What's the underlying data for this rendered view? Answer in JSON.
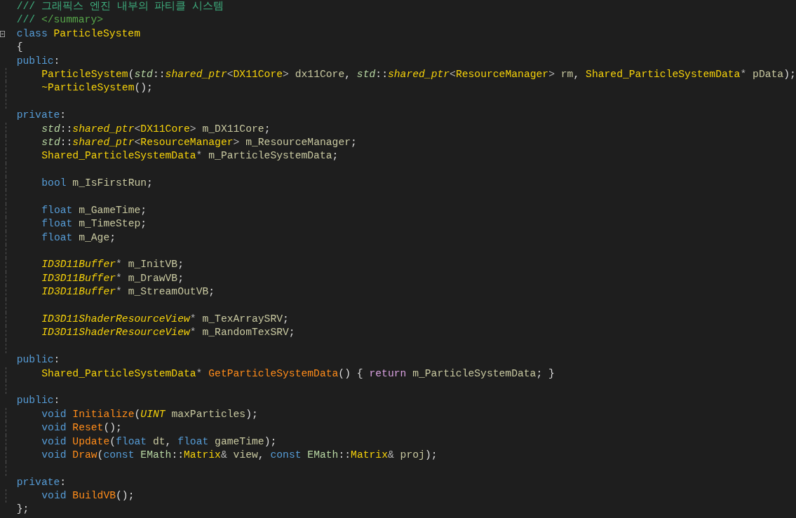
{
  "editor": {
    "lines": [
      {
        "kind": "code",
        "indented": false,
        "tokens": [
          {
            "kind": "comment",
            "t": "/// 그래픽스 엔진 내부의 파티클 시스템"
          }
        ]
      },
      {
        "kind": "code",
        "indented": false,
        "tokens": [
          {
            "kind": "comment",
            "t": "/// "
          },
          {
            "kind": "doc",
            "t": "</summary>"
          }
        ]
      },
      {
        "kind": "code",
        "indented": false,
        "fold_marker": true,
        "tokens": [
          {
            "kind": "kw",
            "t": "class "
          },
          {
            "kind": "class",
            "t": "ParticleSystem"
          }
        ]
      },
      {
        "kind": "code",
        "indented": false,
        "tokens": [
          {
            "kind": "punct",
            "t": "{"
          }
        ]
      },
      {
        "kind": "code",
        "indented": false,
        "tokens": [
          {
            "kind": "kw",
            "t": "public"
          },
          {
            "kind": "punct",
            "t": ":"
          }
        ]
      },
      {
        "kind": "code",
        "indented": true,
        "tokens": [
          {
            "kind": "class",
            "t": "ParticleSystem"
          },
          {
            "kind": "punct",
            "t": "("
          },
          {
            "kind": "ns",
            "t": "std"
          },
          {
            "kind": "punct",
            "t": "::"
          },
          {
            "kind": "tmpl",
            "t": "shared_ptr"
          },
          {
            "kind": "op",
            "t": "<"
          },
          {
            "kind": "class",
            "t": "DX11Core"
          },
          {
            "kind": "op",
            "t": ">"
          },
          {
            "kind": "var",
            "t": " dx11Core"
          },
          {
            "kind": "punct",
            "t": ", "
          },
          {
            "kind": "ns",
            "t": "std"
          },
          {
            "kind": "punct",
            "t": "::"
          },
          {
            "kind": "tmpl",
            "t": "shared_ptr"
          },
          {
            "kind": "op",
            "t": "<"
          },
          {
            "kind": "class",
            "t": "ResourceManager"
          },
          {
            "kind": "op",
            "t": ">"
          },
          {
            "kind": "var",
            "t": " rm"
          },
          {
            "kind": "punct",
            "t": ", "
          },
          {
            "kind": "class",
            "t": "Shared_ParticleSystemData"
          },
          {
            "kind": "op",
            "t": "*"
          },
          {
            "kind": "var",
            "t": " pData"
          },
          {
            "kind": "punct",
            "t": ");"
          }
        ]
      },
      {
        "kind": "code",
        "indented": true,
        "tokens": [
          {
            "kind": "class",
            "t": "~ParticleSystem"
          },
          {
            "kind": "punct",
            "t": "();"
          }
        ]
      },
      {
        "kind": "blank"
      },
      {
        "kind": "code",
        "indented": false,
        "tokens": [
          {
            "kind": "kw",
            "t": "private"
          },
          {
            "kind": "punct",
            "t": ":"
          }
        ]
      },
      {
        "kind": "code",
        "indented": true,
        "tokens": [
          {
            "kind": "ns",
            "t": "std"
          },
          {
            "kind": "punct",
            "t": "::"
          },
          {
            "kind": "tmpl",
            "t": "shared_ptr"
          },
          {
            "kind": "op",
            "t": "<"
          },
          {
            "kind": "class",
            "t": "DX11Core"
          },
          {
            "kind": "op",
            "t": ">"
          },
          {
            "kind": "var",
            "t": " m_DX11Core"
          },
          {
            "kind": "punct",
            "t": ";"
          }
        ]
      },
      {
        "kind": "code",
        "indented": true,
        "tokens": [
          {
            "kind": "ns",
            "t": "std"
          },
          {
            "kind": "punct",
            "t": "::"
          },
          {
            "kind": "tmpl",
            "t": "shared_ptr"
          },
          {
            "kind": "op",
            "t": "<"
          },
          {
            "kind": "class",
            "t": "ResourceManager"
          },
          {
            "kind": "op",
            "t": ">"
          },
          {
            "kind": "var",
            "t": " m_ResourceManager"
          },
          {
            "kind": "punct",
            "t": ";"
          }
        ]
      },
      {
        "kind": "code",
        "indented": true,
        "tokens": [
          {
            "kind": "class",
            "t": "Shared_ParticleSystemData"
          },
          {
            "kind": "op",
            "t": "*"
          },
          {
            "kind": "var",
            "t": " m_ParticleSystemData"
          },
          {
            "kind": "punct",
            "t": ";"
          }
        ]
      },
      {
        "kind": "blank"
      },
      {
        "kind": "code",
        "indented": true,
        "tokens": [
          {
            "kind": "kw",
            "t": "bool"
          },
          {
            "kind": "var",
            "t": " m_IsFirstRun"
          },
          {
            "kind": "punct",
            "t": ";"
          }
        ]
      },
      {
        "kind": "blank"
      },
      {
        "kind": "code",
        "indented": true,
        "tokens": [
          {
            "kind": "kw",
            "t": "float"
          },
          {
            "kind": "var",
            "t": " m_GameTime"
          },
          {
            "kind": "punct",
            "t": ";"
          }
        ]
      },
      {
        "kind": "code",
        "indented": true,
        "tokens": [
          {
            "kind": "kw",
            "t": "float"
          },
          {
            "kind": "var",
            "t": " m_TimeStep"
          },
          {
            "kind": "punct",
            "t": ";"
          }
        ]
      },
      {
        "kind": "code",
        "indented": true,
        "tokens": [
          {
            "kind": "kw",
            "t": "float"
          },
          {
            "kind": "var",
            "t": " m_Age"
          },
          {
            "kind": "punct",
            "t": ";"
          }
        ]
      },
      {
        "kind": "blank"
      },
      {
        "kind": "code",
        "indented": true,
        "tokens": [
          {
            "kind": "type",
            "t": "ID3D11Buffer"
          },
          {
            "kind": "op",
            "t": "*"
          },
          {
            "kind": "var",
            "t": " m_InitVB"
          },
          {
            "kind": "punct",
            "t": ";"
          }
        ]
      },
      {
        "kind": "code",
        "indented": true,
        "tokens": [
          {
            "kind": "type",
            "t": "ID3D11Buffer"
          },
          {
            "kind": "op",
            "t": "*"
          },
          {
            "kind": "var",
            "t": " m_DrawVB"
          },
          {
            "kind": "punct",
            "t": ";"
          }
        ]
      },
      {
        "kind": "code",
        "indented": true,
        "tokens": [
          {
            "kind": "type",
            "t": "ID3D11Buffer"
          },
          {
            "kind": "op",
            "t": "*"
          },
          {
            "kind": "var",
            "t": " m_StreamOutVB"
          },
          {
            "kind": "punct",
            "t": ";"
          }
        ]
      },
      {
        "kind": "blank"
      },
      {
        "kind": "code",
        "indented": true,
        "tokens": [
          {
            "kind": "type",
            "t": "ID3D11ShaderResourceView"
          },
          {
            "kind": "op",
            "t": "*"
          },
          {
            "kind": "var",
            "t": " m_TexArraySRV"
          },
          {
            "kind": "punct",
            "t": ";"
          }
        ]
      },
      {
        "kind": "code",
        "indented": true,
        "tokens": [
          {
            "kind": "type",
            "t": "ID3D11ShaderResourceView"
          },
          {
            "kind": "op",
            "t": "*"
          },
          {
            "kind": "var",
            "t": " m_RandomTexSRV"
          },
          {
            "kind": "punct",
            "t": ";"
          }
        ]
      },
      {
        "kind": "blank"
      },
      {
        "kind": "code",
        "indented": false,
        "tokens": [
          {
            "kind": "kw",
            "t": "public"
          },
          {
            "kind": "punct",
            "t": ":"
          }
        ]
      },
      {
        "kind": "code",
        "indented": true,
        "tokens": [
          {
            "kind": "class",
            "t": "Shared_ParticleSystemData"
          },
          {
            "kind": "op",
            "t": "*"
          },
          {
            "kind": "func",
            "t": " GetParticleSystemData"
          },
          {
            "kind": "punct",
            "t": "() { "
          },
          {
            "kind": "ctrl",
            "t": "return"
          },
          {
            "kind": "var",
            "t": " m_ParticleSystemData"
          },
          {
            "kind": "punct",
            "t": "; }"
          }
        ]
      },
      {
        "kind": "blank"
      },
      {
        "kind": "code",
        "indented": false,
        "tokens": [
          {
            "kind": "kw",
            "t": "public"
          },
          {
            "kind": "punct",
            "t": ":"
          }
        ]
      },
      {
        "kind": "code",
        "indented": true,
        "tokens": [
          {
            "kind": "kw",
            "t": "void"
          },
          {
            "kind": "func",
            "t": " Initialize"
          },
          {
            "kind": "punct",
            "t": "("
          },
          {
            "kind": "type",
            "t": "UINT"
          },
          {
            "kind": "var",
            "t": " maxParticles"
          },
          {
            "kind": "punct",
            "t": ");"
          }
        ]
      },
      {
        "kind": "code",
        "indented": true,
        "tokens": [
          {
            "kind": "kw",
            "t": "void"
          },
          {
            "kind": "func",
            "t": " Reset"
          },
          {
            "kind": "punct",
            "t": "();"
          }
        ]
      },
      {
        "kind": "code",
        "indented": true,
        "tokens": [
          {
            "kind": "kw",
            "t": "void"
          },
          {
            "kind": "func",
            "t": " Update"
          },
          {
            "kind": "punct",
            "t": "("
          },
          {
            "kind": "kw",
            "t": "float"
          },
          {
            "kind": "var",
            "t": " dt"
          },
          {
            "kind": "punct",
            "t": ", "
          },
          {
            "kind": "kw",
            "t": "float"
          },
          {
            "kind": "var",
            "t": " gameTime"
          },
          {
            "kind": "punct",
            "t": ");"
          }
        ]
      },
      {
        "kind": "code",
        "indented": true,
        "tokens": [
          {
            "kind": "kw",
            "t": "void"
          },
          {
            "kind": "func",
            "t": " Draw"
          },
          {
            "kind": "punct",
            "t": "("
          },
          {
            "kind": "kw",
            "t": "const"
          },
          {
            "kind": "ns2",
            "t": " EMath"
          },
          {
            "kind": "punct",
            "t": "::"
          },
          {
            "kind": "class",
            "t": "Matrix"
          },
          {
            "kind": "op",
            "t": "&"
          },
          {
            "kind": "var",
            "t": " view"
          },
          {
            "kind": "punct",
            "t": ", "
          },
          {
            "kind": "kw",
            "t": "const"
          },
          {
            "kind": "ns2",
            "t": " EMath"
          },
          {
            "kind": "punct",
            "t": "::"
          },
          {
            "kind": "class",
            "t": "Matrix"
          },
          {
            "kind": "op",
            "t": "&"
          },
          {
            "kind": "var",
            "t": " proj"
          },
          {
            "kind": "punct",
            "t": ");"
          }
        ]
      },
      {
        "kind": "blank"
      },
      {
        "kind": "code",
        "indented": false,
        "tokens": [
          {
            "kind": "kw",
            "t": "private"
          },
          {
            "kind": "punct",
            "t": ":"
          }
        ]
      },
      {
        "kind": "code",
        "indented": true,
        "tokens": [
          {
            "kind": "kw",
            "t": "void"
          },
          {
            "kind": "func",
            "t": " BuildVB"
          },
          {
            "kind": "punct",
            "t": "();"
          }
        ]
      },
      {
        "kind": "code",
        "indented": false,
        "tokens": [
          {
            "kind": "punct",
            "t": "};"
          }
        ]
      }
    ]
  }
}
